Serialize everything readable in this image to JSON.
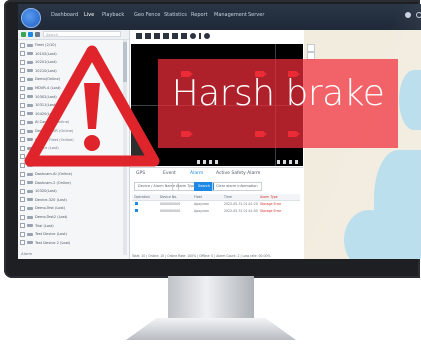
{
  "header": {
    "nav": [
      "Dashboard",
      "Live",
      "Playback",
      "Geo Fence",
      "Statistics",
      "Report",
      "Management",
      "Server"
    ],
    "active_nav": "Live"
  },
  "sidebar": {
    "search_placeholder": "Search",
    "tree_items": [
      "Fleet (2/10)",
      "10102(Lost)",
      "10201(Lost)",
      "10210(Lost)",
      "Demo(Online)",
      "MDVR-4 (Lost)",
      "10302(Lost)",
      "10311(Lost)",
      "10420(Lost)",
      "AI Camera (Online)",
      "Demo-MDVR (Online)",
      "Default Fleet (Online)",
      "Device (Lost)",
      "Dashcam (Lost)",
      "10401(Lost)",
      "Dashcam-AI (Online)",
      "Dashcam-2 (Online)",
      "10320(Lost)",
      "Device-320 (Lost)",
      "Demo-Test (Lost)",
      "Demo-Test2 (Lost)",
      "Trial (Lost)",
      "Test Device (Lost)",
      "Test Device 2 (Lost)"
    ],
    "footer": "Alarm"
  },
  "bottom_panel": {
    "tabs": [
      "GPS",
      "Event",
      "Alarm",
      "Active Safety Alarm"
    ],
    "filters": [
      "Device / Alarm Name",
      "Alarm Type",
      "Clear alarm information"
    ],
    "search_label": "Search",
    "columns": [
      "Operation",
      "Device No.",
      "Fleet",
      "Time",
      "Alarm Type"
    ],
    "rows": [
      {
        "device": "0000000000",
        "fleet": "Apoyvron",
        "time": "2022-05-31 01:41:20",
        "alarm": "Storage Error"
      },
      {
        "device": "0000000000",
        "fleet": "Apoyvron",
        "time": "2022-05-31 01:41:05",
        "alarm": "Storage Error"
      }
    ],
    "status": "Total: 10 | Online: 10 | Online Rate: 100% | Offline: 0 | Alarm Count: 2 | Loss rate: 00.00%"
  },
  "banner": {
    "text": "Harsh brake"
  },
  "colors": {
    "banner": "#f12e3a",
    "warning": "#e0242c",
    "topbar": "#25303f"
  },
  "icons": {
    "warning": "warning-triangle-icon",
    "camera": "camera-icon"
  }
}
